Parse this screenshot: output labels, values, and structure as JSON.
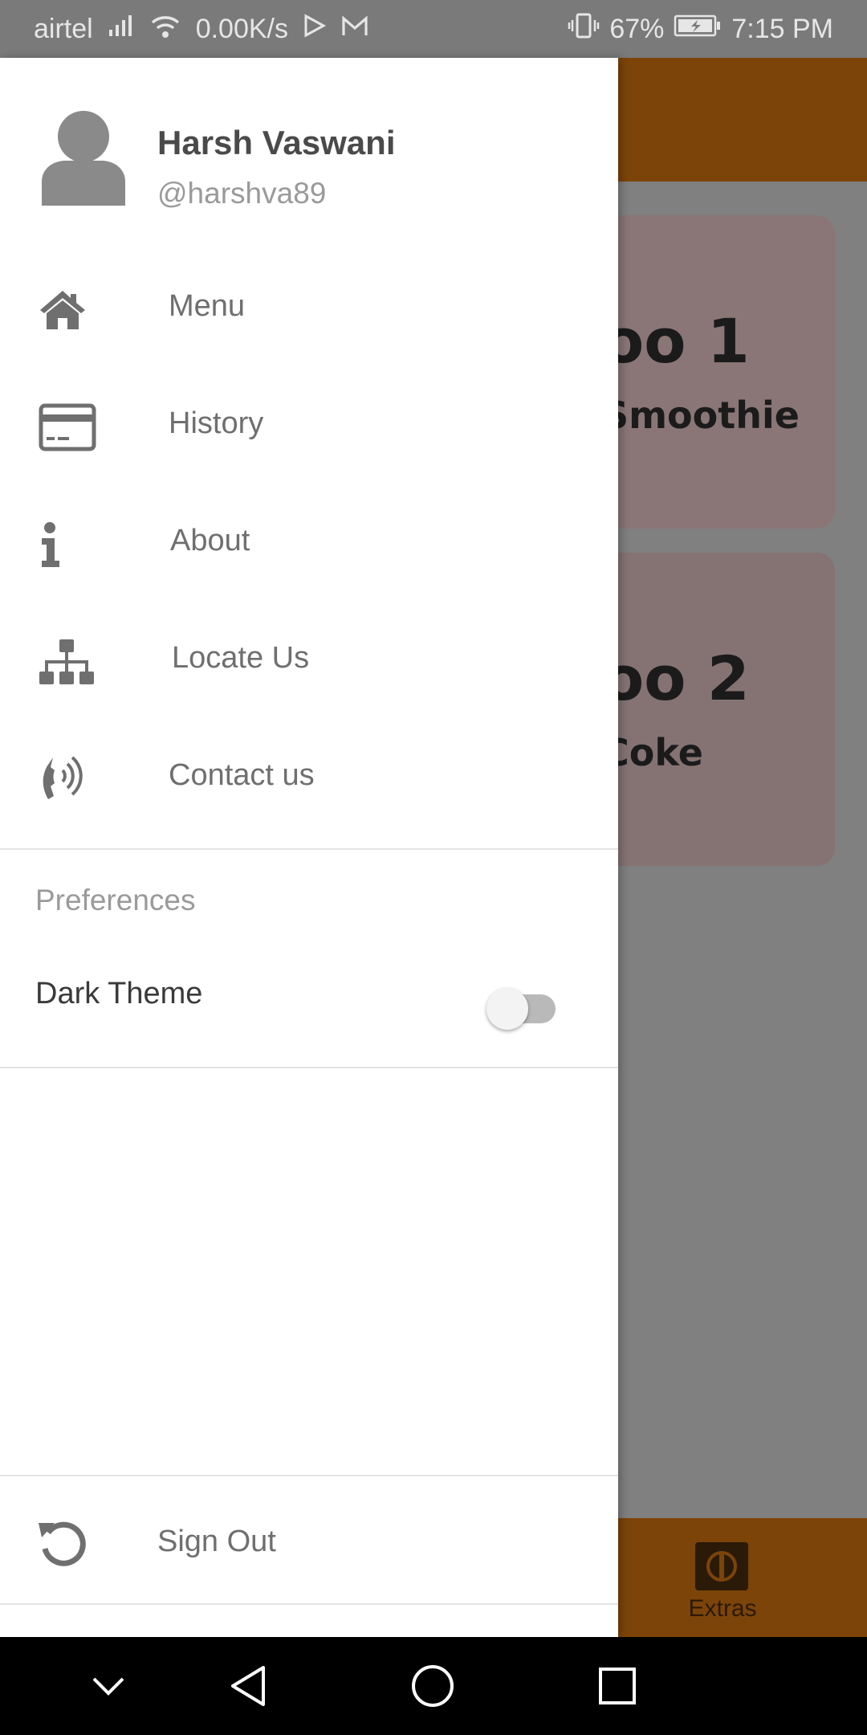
{
  "status_bar": {
    "carrier": "airtel",
    "net_speed": "0.00K/s",
    "battery": "67%",
    "time": "7:15 PM",
    "icons": [
      "signal-icon",
      "wifi-icon",
      "play-store-icon",
      "gmail-icon",
      "vibrate-icon",
      "battery-charging-icon"
    ]
  },
  "background_app": {
    "cards": [
      {
        "title": "oo 1",
        "subtitle": "Smoothie"
      },
      {
        "title": "oo 2",
        "subtitle": "Coke"
      }
    ],
    "bottom_nav_label": "Extras",
    "colors": {
      "accent": "#7c4409"
    }
  },
  "drawer": {
    "profile": {
      "name": "Harsh Vaswani",
      "handle": "@harshva89",
      "icon": "user-avatar-icon"
    },
    "items": [
      {
        "label": "Menu",
        "icon": "home-icon"
      },
      {
        "label": "History",
        "icon": "credit-card-icon"
      },
      {
        "label": "About",
        "icon": "info-icon"
      },
      {
        "label": "Locate Us",
        "icon": "sitemap-icon"
      },
      {
        "label": "Contact us",
        "icon": "phone-volume-icon"
      }
    ],
    "preferences": {
      "title": "Preferences",
      "dark_theme_label": "Dark Theme",
      "dark_theme_on": false
    },
    "sign_out": {
      "label": "Sign Out",
      "icon": "undo-icon"
    }
  },
  "nav_bar": {
    "buttons": [
      "chevron-down-icon",
      "back-icon",
      "home-circle-icon",
      "recents-icon"
    ]
  }
}
